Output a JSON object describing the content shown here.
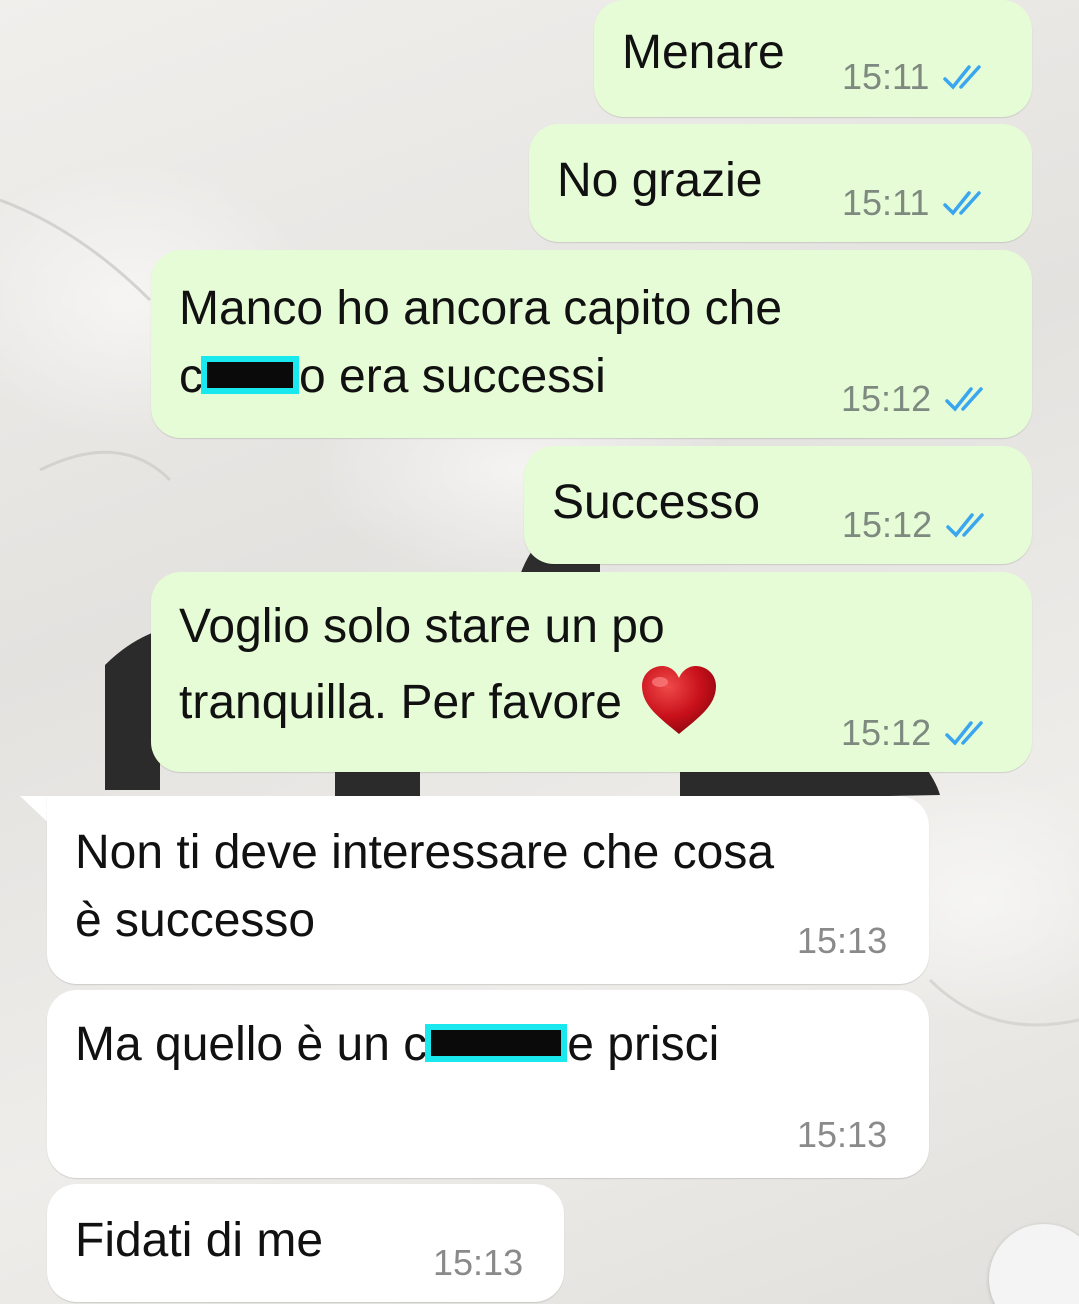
{
  "chat": {
    "messages": [
      {
        "direction": "outgoing",
        "text": "Menare",
        "time": "15:11",
        "status": "read-double-check"
      },
      {
        "direction": "outgoing",
        "text": "No grazie",
        "time": "15:11",
        "status": "read-double-check"
      },
      {
        "direction": "outgoing",
        "line1": "Manco ho ancora capito che",
        "line2_prefix": "c",
        "line2_suffix": "o era successi",
        "time": "15:12",
        "status": "read-double-check"
      },
      {
        "direction": "outgoing",
        "text": "Successo",
        "time": "15:12",
        "status": "read-double-check"
      },
      {
        "direction": "outgoing",
        "line1": "Voglio solo stare un po",
        "line2": "tranquilla. Per favore",
        "emoji": "heart-emoji",
        "time": "15:12",
        "status": "read-double-check"
      },
      {
        "direction": "incoming",
        "line1": "Non ti deve interessare che cosa",
        "line2": "è successo",
        "time": "15:13"
      },
      {
        "direction": "incoming",
        "prefix": "Ma quello è un c",
        "suffix": "e prisci",
        "time": "15:13"
      },
      {
        "direction": "incoming",
        "text": "Fidati di me",
        "time": "15:13"
      }
    ]
  },
  "icons": {
    "read_ticks": "double-check-icon",
    "redaction": "redaction-box",
    "heart": "heart-emoji"
  },
  "colors": {
    "outgoing_bubble": "#e6fcd6",
    "incoming_bubble": "#ffffff",
    "read_ticks": "#3aa6f0",
    "redaction_border": "#19e8ee"
  }
}
